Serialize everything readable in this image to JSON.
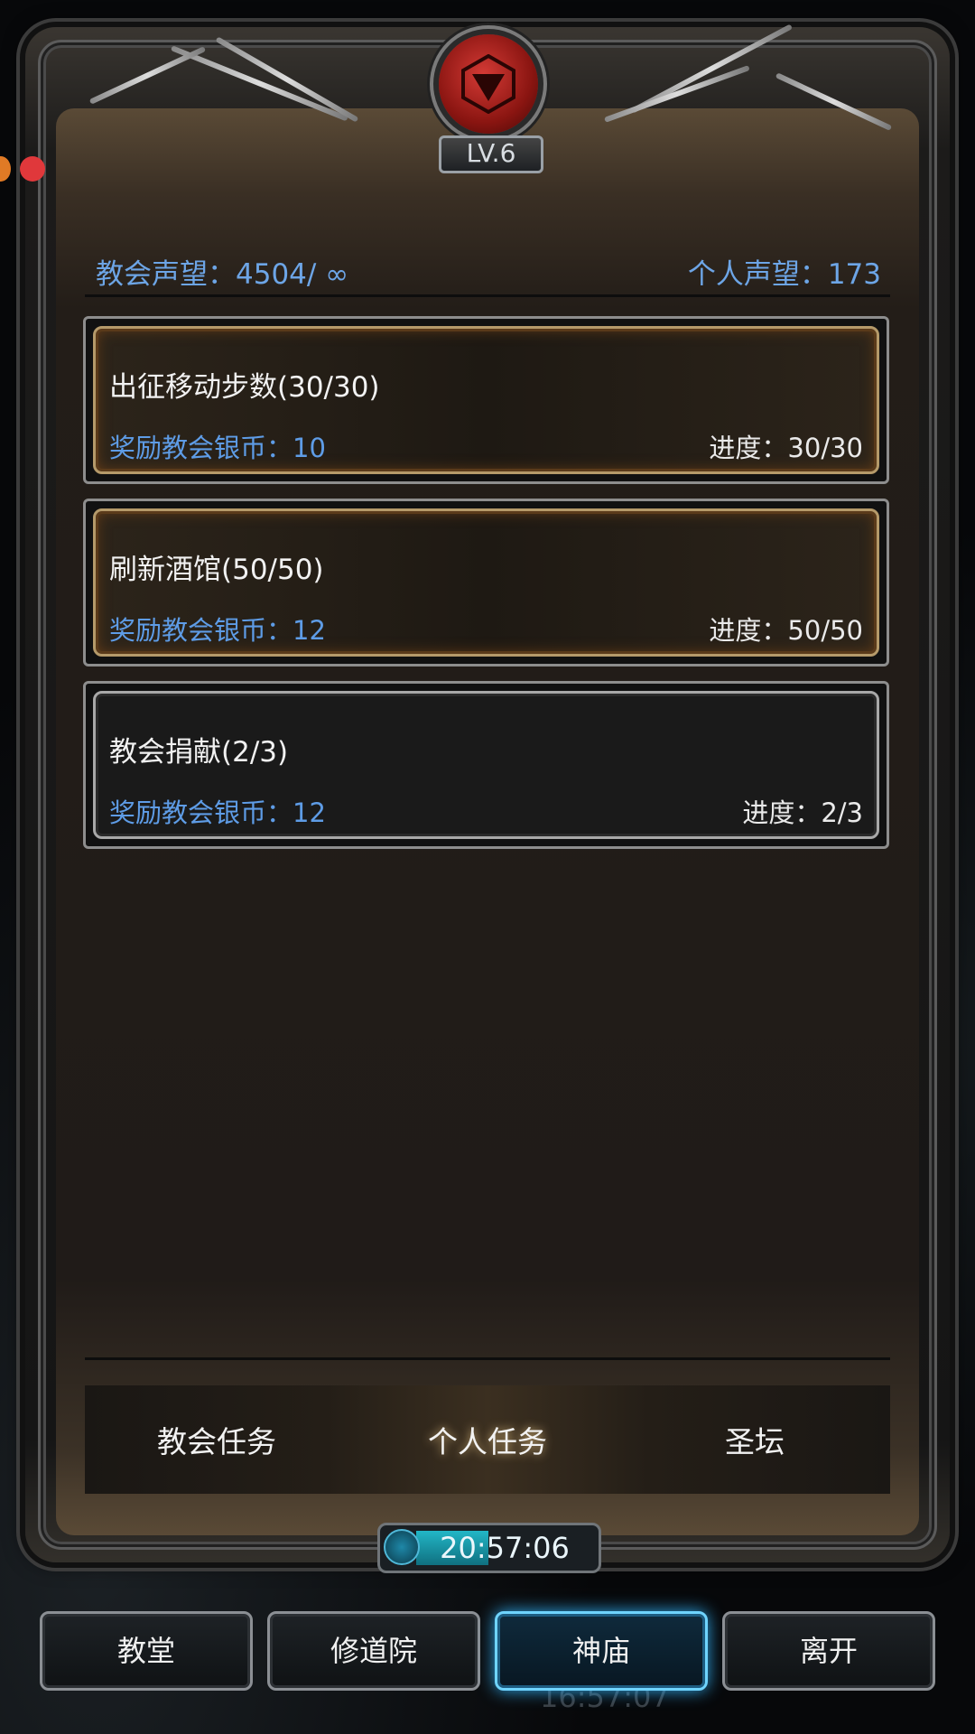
{
  "level_badge": "LV.6",
  "stats": {
    "church_reputation": "教会声望：4504/ ∞",
    "personal_reputation": "个人声望：173"
  },
  "tasks": [
    {
      "title": "出征移动步数(30/30)",
      "reward": "奖励教会银币：10",
      "progress": "进度：30/30",
      "status": "complete"
    },
    {
      "title": "刷新酒馆(50/50)",
      "reward": "奖励教会银币：12",
      "progress": "进度：50/50",
      "status": "complete"
    },
    {
      "title": "教会捐献(2/3)",
      "reward": "奖励教会银币：12",
      "progress": "进度：2/3",
      "status": "incomplete"
    }
  ],
  "tabs": [
    {
      "label": "教会任务",
      "active": false
    },
    {
      "label": "个人任务",
      "active": true
    },
    {
      "label": "圣坛",
      "active": false
    }
  ],
  "timer": {
    "text": "20:57:06",
    "fill_fraction": 0.33
  },
  "background_time": "16:57:07",
  "nav": [
    {
      "label": "教堂",
      "active": false
    },
    {
      "label": "修道院",
      "active": false
    },
    {
      "label": "神庙",
      "active": true
    },
    {
      "label": "离开",
      "active": false
    }
  ],
  "colors": {
    "accent_blue": "#5e9ce6",
    "active_glow": "#6fd4ff",
    "notification_red": "#e0383b"
  }
}
